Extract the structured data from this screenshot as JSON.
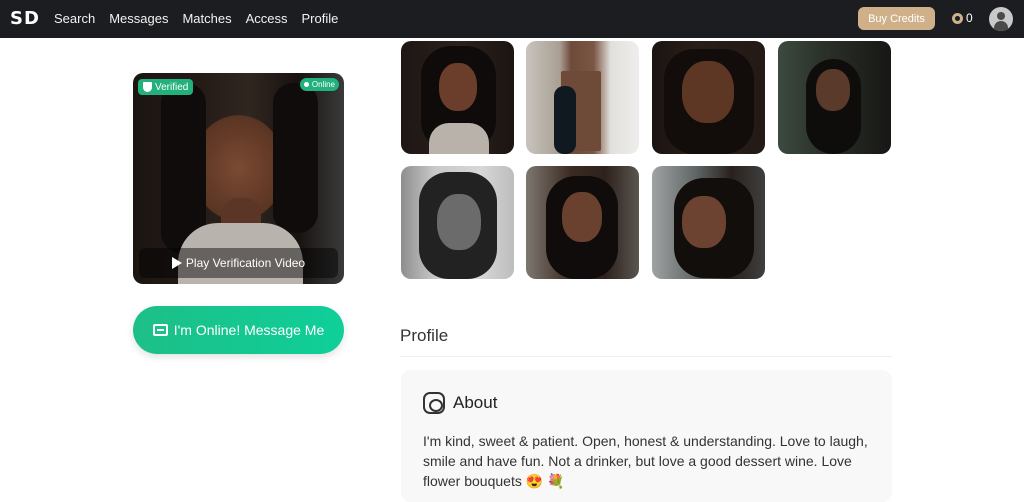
{
  "header": {
    "logo": "SD",
    "nav": [
      "Search",
      "Messages",
      "Matches",
      "Access",
      "Profile"
    ],
    "buy_credits": "Buy Credits",
    "credits": "0"
  },
  "profile_photo": {
    "verified_label": "Verified",
    "online_label": "Online",
    "play_label": "Play Verification Video"
  },
  "message_button": "I'm Online! Message Me",
  "gallery_count": 7,
  "profile_section": {
    "title": "Profile",
    "about_title": "About",
    "about_text": "I'm kind, sweet & patient. Open, honest & understanding. Love to laugh, smile and have fun. Not a drinker, but love a good dessert wine. Love flower bouquets 😍 💐"
  },
  "colors": {
    "topbar": "#1b1d20",
    "accent_green": "#1dbf87",
    "gold": "#cfb089"
  }
}
